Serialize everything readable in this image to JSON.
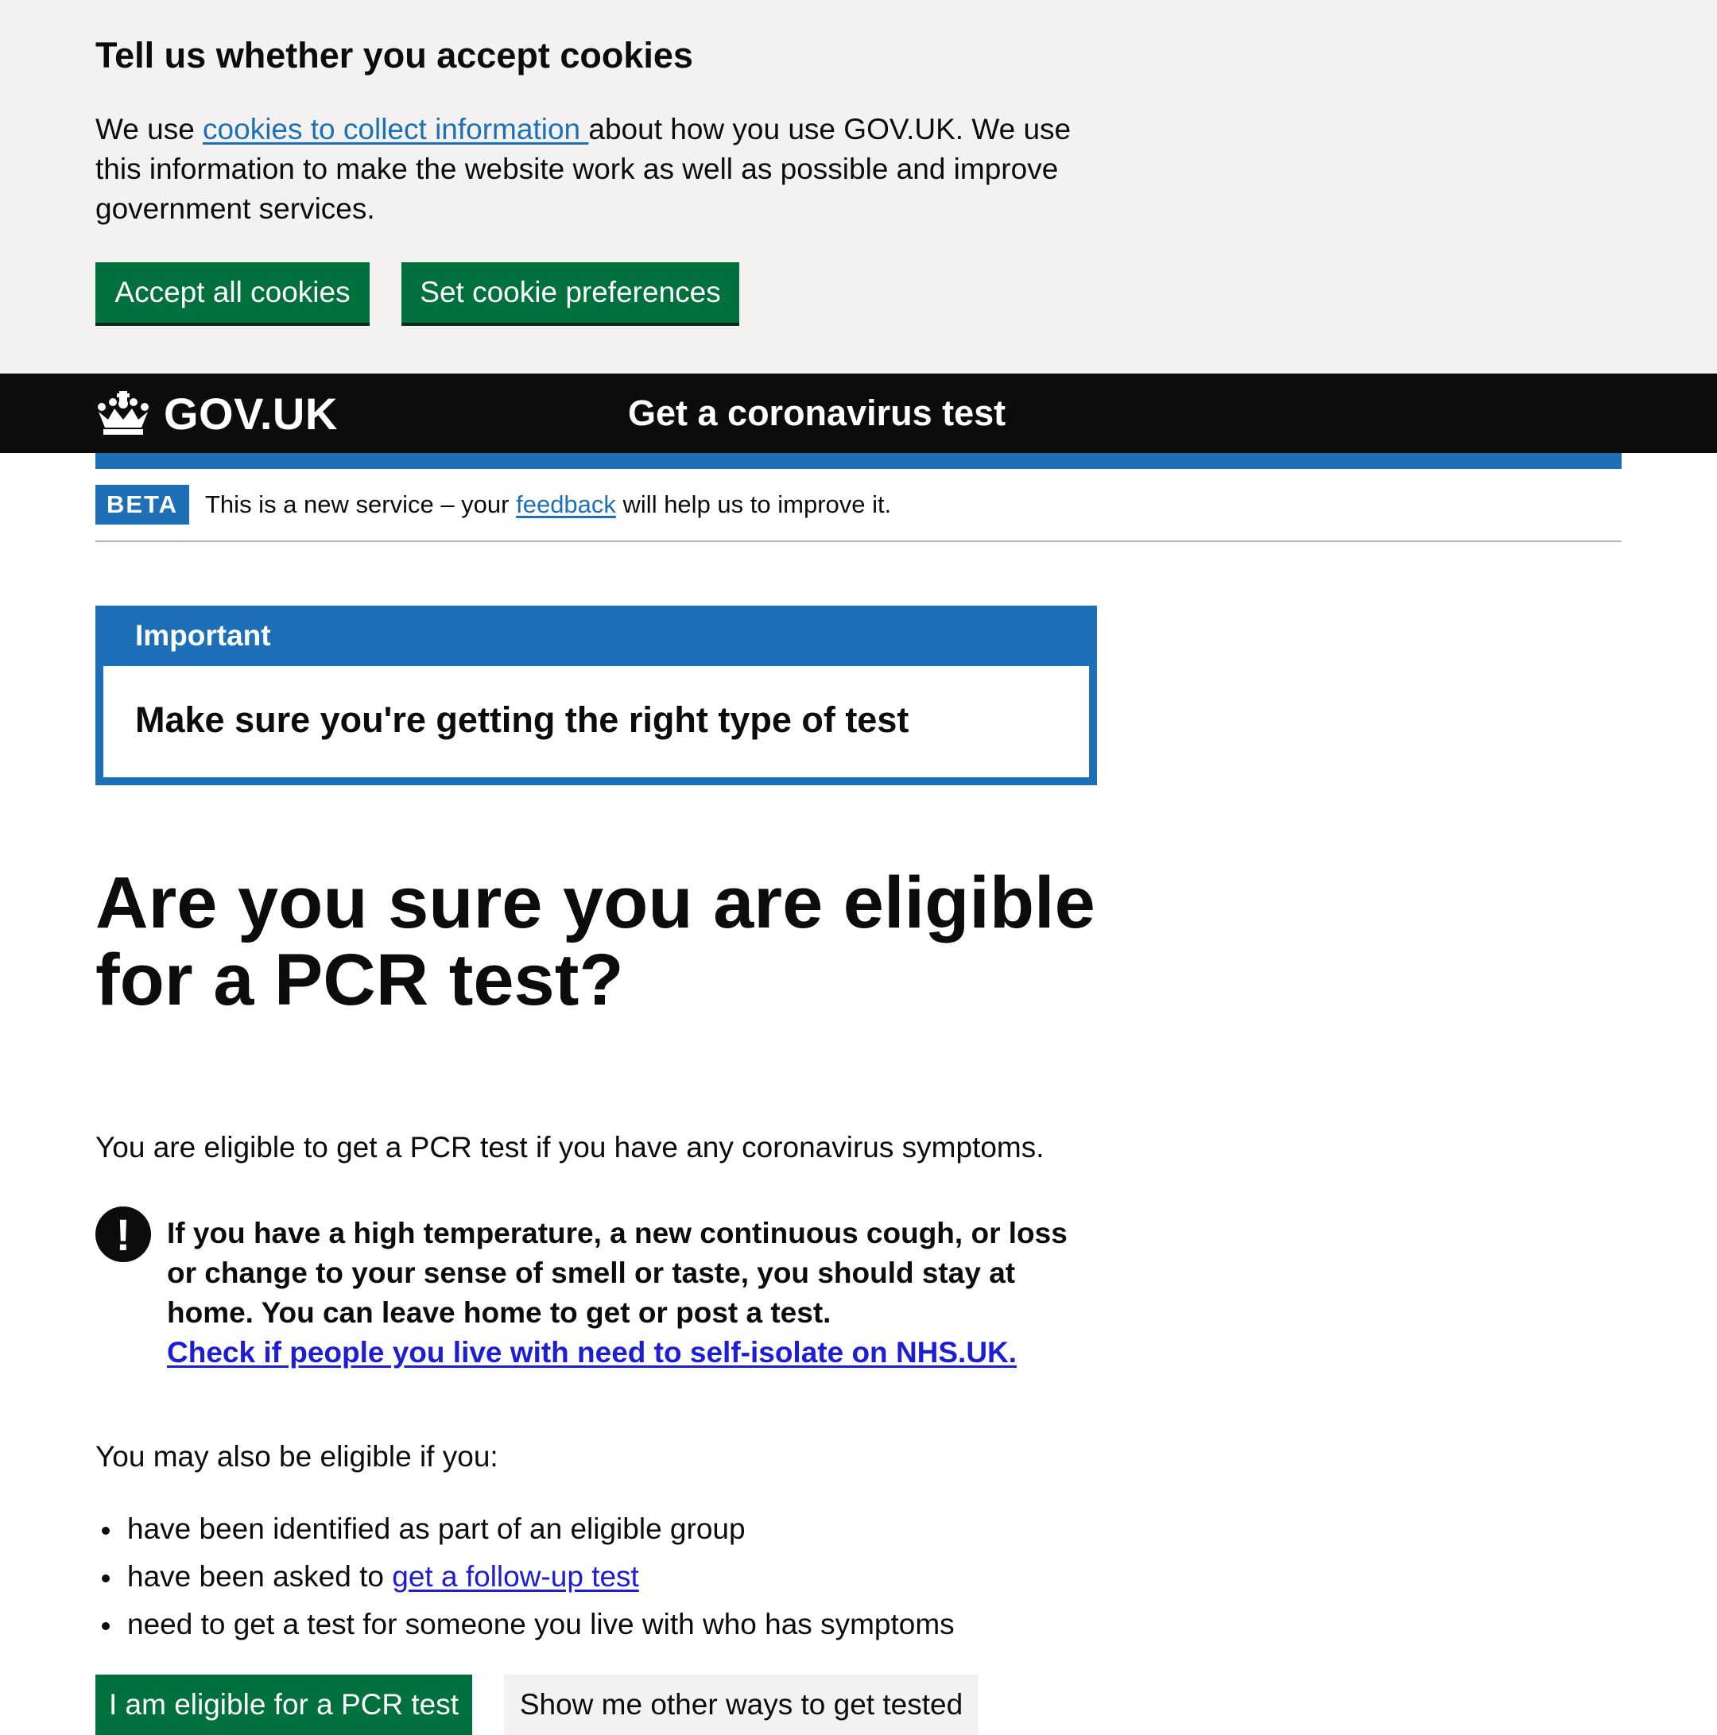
{
  "cookie_banner": {
    "title": "Tell us whether you accept cookies",
    "text_before_link": "We use ",
    "link_text": "cookies to collect information ",
    "text_after_link": "about how you use GOV.UK. We use this information to make the website work as well as possible and improve government services.",
    "accept_button": "Accept all cookies",
    "preferences_button": "Set cookie preferences"
  },
  "header": {
    "logo_text": "GOV.UK",
    "service_name": "Get a coronavirus test"
  },
  "phase_banner": {
    "tag": "BETA",
    "text_before_link": "This is a new service – your ",
    "link_text": "feedback",
    "text_after_link": " will help us to improve it."
  },
  "important": {
    "label": "Important",
    "body": "Make sure you're getting the right type of test"
  },
  "main": {
    "heading": "Are you sure you are eligible for a PCR test?",
    "intro": "You are eligible to get a PCR test if you have any coronavirus symptoms.",
    "warning": {
      "icon": "!",
      "text": "If you have a high temperature, a new continuous cough, or loss or change to your sense of smell or taste, you should stay at home. You can leave home to get or post a test.",
      "link_text": "Check if people you live with need to self-isolate on NHS.UK."
    },
    "also_eligible": "You may also be eligible if you:",
    "list": {
      "item1": "have been identified as part of an eligible group",
      "item2_before": "have been asked to ",
      "item2_link": "get a follow-up test",
      "item3": "need to get a test for someone you live with who has symptoms"
    },
    "primary_button": "I am eligible for a PCR test",
    "secondary_button": "Show me other ways to get tested"
  }
}
